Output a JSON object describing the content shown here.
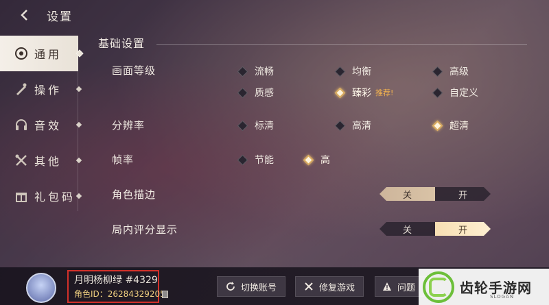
{
  "header": {
    "title": "设置"
  },
  "sidebar": {
    "items": [
      {
        "label": "通用",
        "icon": "general-icon",
        "active": true
      },
      {
        "label": "操作",
        "icon": "operation-icon"
      },
      {
        "label": "音效",
        "icon": "headphones-icon"
      },
      {
        "label": "其他",
        "icon": "tools-icon"
      },
      {
        "label": "礼包码",
        "icon": "gift-icon"
      }
    ]
  },
  "main": {
    "section_title": "基础设置",
    "graphics": {
      "label": "画面等级",
      "options": [
        "流畅",
        "均衡",
        "高级",
        "质感",
        "臻彩",
        "自定义"
      ],
      "selected": "臻彩",
      "recommend_tag": "推荐!"
    },
    "resolution": {
      "label": "分辨率",
      "options": [
        "标清",
        "高清",
        "超清"
      ],
      "selected": "超清"
    },
    "framerate": {
      "label": "帧率",
      "options": [
        "节能",
        "高"
      ],
      "selected": "高"
    },
    "outline": {
      "label": "角色描边",
      "off": "关",
      "on": "开",
      "value": "关"
    },
    "score_display": {
      "label": "局内评分显示",
      "off": "关",
      "on": "开",
      "value": "开"
    }
  },
  "footer": {
    "username": "月明杨柳绿 #4329",
    "role_id": "角色ID：26284329205",
    "buttons": [
      "切换账号",
      "修复游戏",
      "问题"
    ]
  },
  "watermark": {
    "text": "齿轮手游网",
    "sub": "SLOGAN"
  },
  "colors": {
    "accent": "#f3b34f",
    "highlight_box": "#d3302a"
  }
}
